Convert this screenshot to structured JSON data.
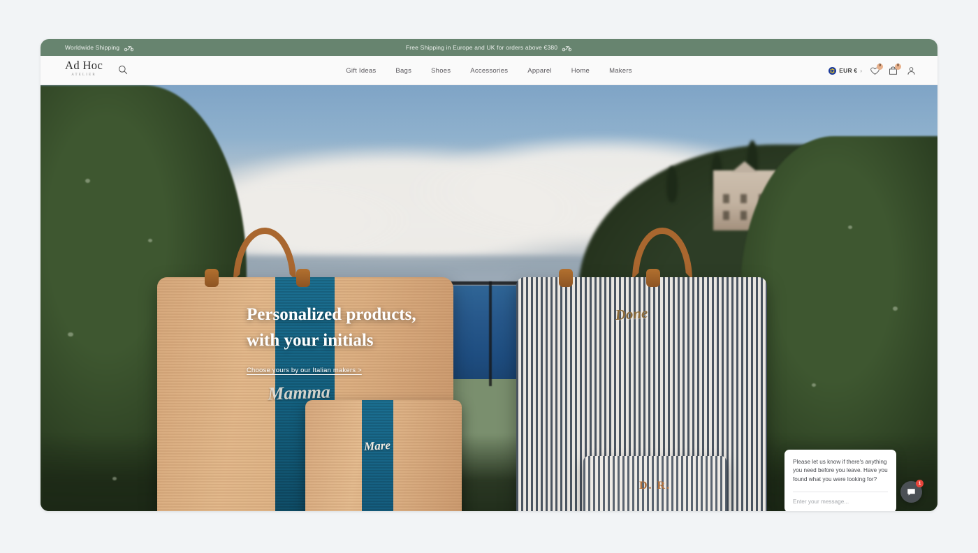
{
  "announcement": {
    "left": "Worldwide Shipping",
    "center": "Free Shipping in Europe and UK for orders above €380",
    "icon": "scooter-icon",
    "background": "#67846f",
    "text_color": "#eef1ee"
  },
  "header": {
    "brand_name": "Ad Hoc",
    "brand_sub": "ATELIER",
    "search_icon": "search-icon",
    "nav": [
      {
        "label": "Gift Ideas"
      },
      {
        "label": "Bags"
      },
      {
        "label": "Shoes"
      },
      {
        "label": "Accessories"
      },
      {
        "label": "Apparel"
      },
      {
        "label": "Home"
      },
      {
        "label": "Makers"
      }
    ],
    "currency": {
      "label": "EUR €",
      "flag": "eu-flag-icon",
      "chevron": "›"
    },
    "wishlist": {
      "icon": "heart-icon",
      "count": "0"
    },
    "cart": {
      "icon": "shopping-bag-icon",
      "count": "0"
    },
    "account": {
      "icon": "user-icon"
    }
  },
  "hero": {
    "title_line1": "Personalized products,",
    "title_line2": "with your initials",
    "cta": "Choose yours by our Italian makers  >",
    "embroidery": {
      "large_bag": "Mamma",
      "front_pouch": "Mare",
      "striped_bag": "Done",
      "striped_pouch": "D. R."
    }
  },
  "chat": {
    "message": "Please let us know if there's anything you need before you leave. Have you found what you were looking for?",
    "input_placeholder": "Enter your message...",
    "fab_icon": "chat-bubble-icon",
    "unread_count": "1",
    "badge_color": "#e8443a"
  }
}
